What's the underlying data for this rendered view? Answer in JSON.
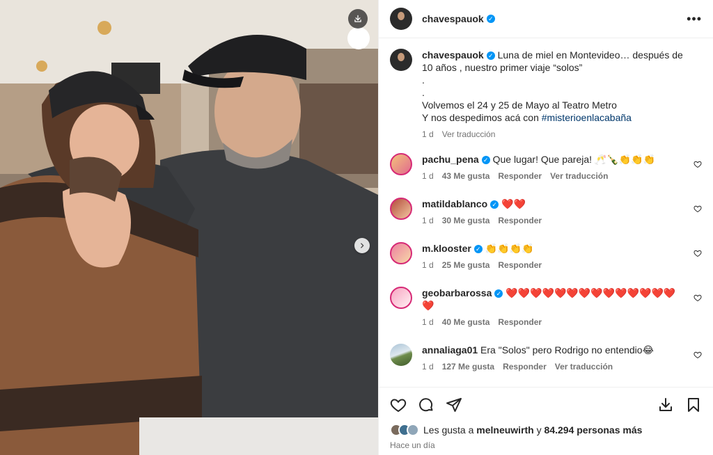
{
  "post": {
    "author": "chavespauok",
    "caption": {
      "author": "chavespauok",
      "line1": "Luna de miel en Montevideo… después de 10 años , nuestro primer viaje “solos”",
      "dot1": ".",
      "dot2": ".",
      "line2": "Volvemos el 24 y 25 de Mayo al Teatro Metro",
      "line3_prefix": "Y nos despedimos acá con",
      "hashtag": "#misterioenlacabaña",
      "time": "1 d",
      "translate": "Ver traducción"
    },
    "more_icon": "more-horizontal-icon"
  },
  "comments": [
    {
      "user": "pachu_pena",
      "verified": true,
      "text": "Que lugar! Que pareja! 🥂🍾👏👏👏",
      "time": "1 d",
      "likes": "43 Me gusta",
      "reply": "Responder",
      "translate": "Ver traducción"
    },
    {
      "user": "matildablanco",
      "verified": true,
      "text": "❤️❤️",
      "time": "1 d",
      "likes": "30 Me gusta",
      "reply": "Responder"
    },
    {
      "user": "m.klooster",
      "verified": true,
      "text": "👏👏👏👏",
      "time": "1 d",
      "likes": "25 Me gusta",
      "reply": "Responder"
    },
    {
      "user": "geobarbarossa",
      "verified": true,
      "text": "❤️❤️❤️❤️❤️❤️❤️❤️❤️❤️❤️❤️❤️❤️ ❤️",
      "time": "1 d",
      "likes": "40 Me gusta",
      "reply": "Responder"
    },
    {
      "user": "annaliaga01",
      "verified": false,
      "text": "Era \"Solos\" pero Rodrigo no entendio😂",
      "time": "1 d",
      "likes": "127 Me gusta",
      "reply": "Responder",
      "translate": "Ver traducción"
    }
  ],
  "footer": {
    "likes_prefix": "Les gusta a",
    "likes_user": "melneuwirth",
    "likes_mid": "y",
    "likes_count": "84.294 personas más",
    "when": "Hace un día"
  },
  "colors": {
    "link": "#00376b",
    "verified": "#0095f6",
    "muted": "#737373"
  }
}
